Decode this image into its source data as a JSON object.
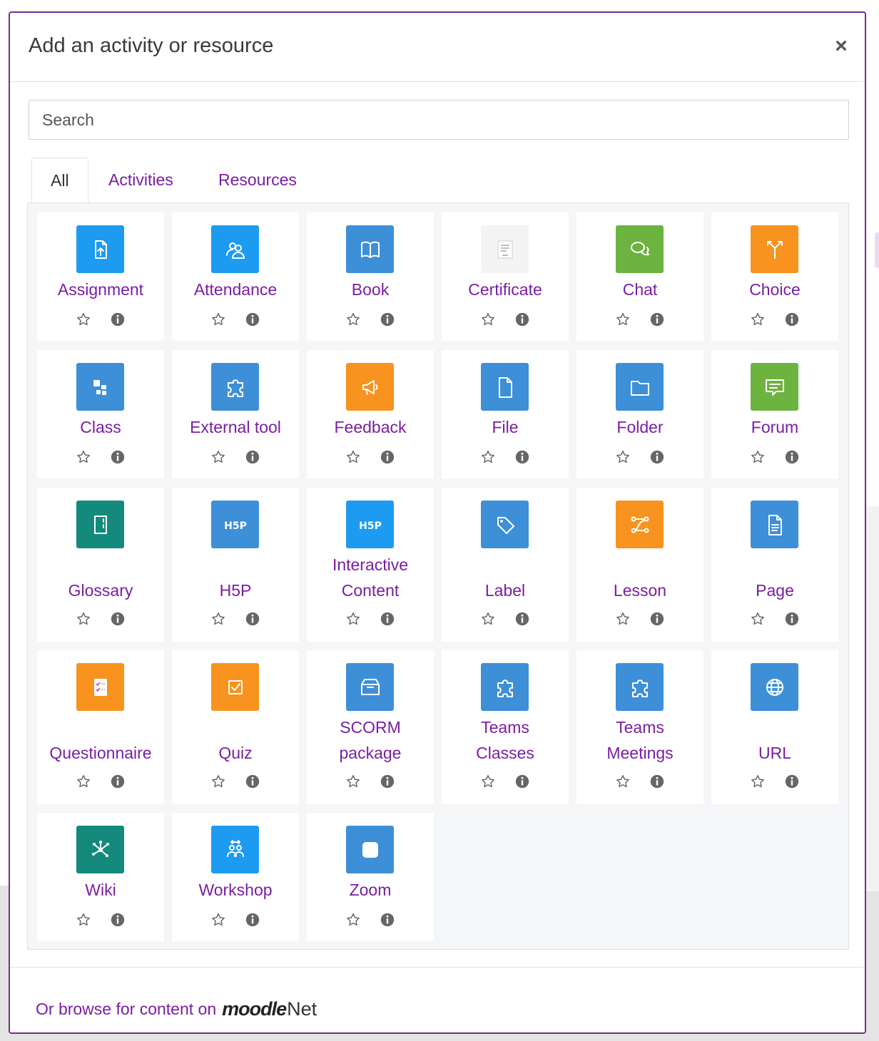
{
  "modal": {
    "title": "Add an activity or resource",
    "close_glyph": "×",
    "search_placeholder": "Search"
  },
  "tabs": [
    {
      "label": "All",
      "active": true
    },
    {
      "label": "Activities",
      "active": false
    },
    {
      "label": "Resources",
      "active": false
    }
  ],
  "items": [
    {
      "name": "Assignment",
      "icon": "assignment-icon",
      "color": "#1d9bf0"
    },
    {
      "name": "Attendance",
      "icon": "attendance-icon",
      "color": "#1d9bf0"
    },
    {
      "name": "Book",
      "icon": "book-icon",
      "color": "#3d8fd8"
    },
    {
      "name": "Certificate",
      "icon": "certificate-icon",
      "color": "#f4f4f4"
    },
    {
      "name": "Chat",
      "icon": "chat-icon",
      "color": "#6cb33f"
    },
    {
      "name": "Choice",
      "icon": "choice-icon",
      "color": "#f7931e"
    },
    {
      "name": "Class",
      "icon": "class-icon",
      "color": "#3d8fd8"
    },
    {
      "name": "External tool",
      "icon": "puzzle-icon",
      "color": "#3d8fd8"
    },
    {
      "name": "Feedback",
      "icon": "megaphone-icon",
      "color": "#f7931e"
    },
    {
      "name": "File",
      "icon": "file-icon",
      "color": "#3d8fd8"
    },
    {
      "name": "Folder",
      "icon": "folder-icon",
      "color": "#3d8fd8"
    },
    {
      "name": "Forum",
      "icon": "forum-icon",
      "color": "#6cb33f"
    },
    {
      "name": "Glossary",
      "icon": "glossary-icon",
      "color": "#138a7b"
    },
    {
      "name": "H5P",
      "icon": "h5p-icon",
      "color": "#3d8fd8"
    },
    {
      "name": "Interactive Content",
      "icon": "h5p-icon",
      "color": "#1d9bf0"
    },
    {
      "name": "Label",
      "icon": "tag-icon",
      "color": "#3d8fd8"
    },
    {
      "name": "Lesson",
      "icon": "lesson-icon",
      "color": "#f7931e"
    },
    {
      "name": "Page",
      "icon": "page-icon",
      "color": "#3d8fd8"
    },
    {
      "name": "Questionnaire",
      "icon": "questionnaire-icon",
      "color": "#f7931e"
    },
    {
      "name": "Quiz",
      "icon": "quiz-icon",
      "color": "#f7931e"
    },
    {
      "name": "SCORM package",
      "icon": "box-icon",
      "color": "#3d8fd8"
    },
    {
      "name": "Teams Classes",
      "icon": "puzzle-icon",
      "color": "#3d8fd8"
    },
    {
      "name": "Teams Meetings",
      "icon": "puzzle-icon",
      "color": "#3d8fd8"
    },
    {
      "name": "URL",
      "icon": "globe-icon",
      "color": "#3d8fd8"
    },
    {
      "name": "Wiki",
      "icon": "wiki-icon",
      "color": "#138a7b"
    },
    {
      "name": "Workshop",
      "icon": "workshop-icon",
      "color": "#1d9bf0"
    },
    {
      "name": "Zoom",
      "icon": "zoom-icon",
      "color": "#3d8fd8"
    }
  ],
  "footer": {
    "browse_text": "Or browse for content on",
    "logo_moodle": "moodle",
    "logo_net": "Net"
  },
  "colors": {
    "accent": "#7a1ea1",
    "modal_border": "#7a2a8f"
  }
}
